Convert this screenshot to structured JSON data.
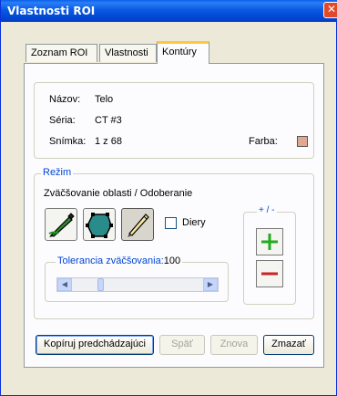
{
  "window": {
    "title": "Vlastnosti ROI",
    "close_glyph": "✕"
  },
  "tabs": [
    {
      "label": "Zoznam ROI",
      "active": false
    },
    {
      "label": "Vlastnosti",
      "active": false
    },
    {
      "label": "Kontúry",
      "active": true
    }
  ],
  "info": {
    "name_label": "Názov:",
    "name_value": "Telo",
    "series_label": "Séria:",
    "series_value": "CT #3",
    "slice_label": "Snímka:",
    "slice_value": "1 z 68",
    "color_label": "Farba:",
    "color_value": "#e0a890"
  },
  "mode": {
    "legend": "Režim",
    "description": "Zväčšovanie oblasti / Odoberanie",
    "tools": [
      {
        "icon": "pencil-fill-icon",
        "selected": false
      },
      {
        "icon": "polygon-icon",
        "selected": false
      },
      {
        "icon": "pen-stroke-icon",
        "selected": true
      }
    ],
    "holes_label": "Diery",
    "holes_checked": false,
    "plusminus_legend": "+ / -",
    "plus_glyph": "+",
    "minus_glyph": "−",
    "tolerance_label": "Tolerancia zväčšovania:",
    "tolerance_value": "100"
  },
  "buttons": {
    "copy_previous": "Kopíruj predchádzajúci",
    "back": "Späť",
    "redo": "Znova",
    "delete": "Zmazať"
  },
  "colors": {
    "plus": "#22aa22",
    "minus": "#cc2222",
    "accent": "#0046d5"
  }
}
